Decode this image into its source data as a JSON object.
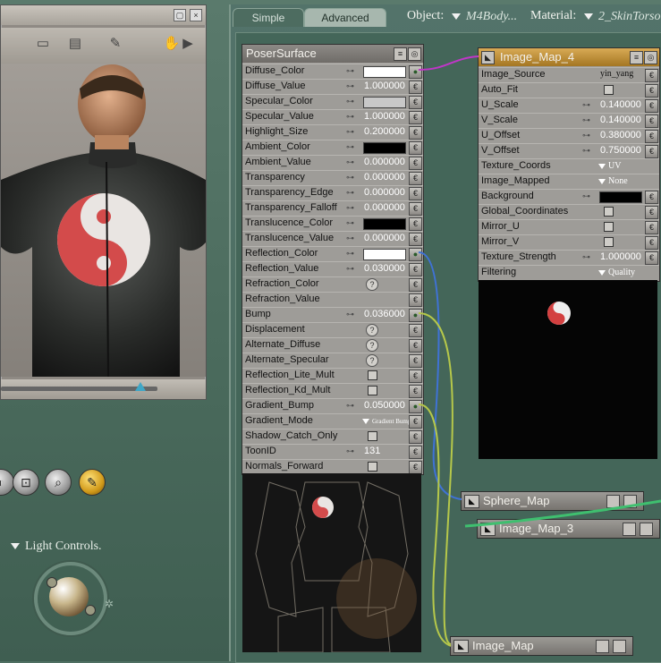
{
  "tabs": [
    {
      "label": "Simple"
    },
    {
      "label": "Advanced"
    }
  ],
  "header": {
    "object_label": "Object:",
    "object_value": "M4Body...",
    "material_label": "Material:",
    "material_value": "2_SkinTorso"
  },
  "viewport": {
    "light_controls_label": "Light Controls."
  },
  "poser_surface": {
    "title": "PoserSurface",
    "rows": [
      {
        "label": "Diffuse_Color",
        "value": "",
        "kind": "color",
        "color": "#ffffff",
        "plug": "connected"
      },
      {
        "label": "Diffuse_Value",
        "value": "1.000000",
        "kind": "number"
      },
      {
        "label": "Specular_Color",
        "value": "",
        "kind": "color",
        "color": "#c8c8c8"
      },
      {
        "label": "Specular_Value",
        "value": "1.000000",
        "kind": "number"
      },
      {
        "label": "Highlight_Size",
        "value": "0.200000",
        "kind": "number"
      },
      {
        "label": "Ambient_Color",
        "value": "",
        "kind": "color",
        "color": "#000000"
      },
      {
        "label": "Ambient_Value",
        "value": "0.000000",
        "kind": "number"
      },
      {
        "label": "Transparency",
        "value": "0.000000",
        "kind": "number"
      },
      {
        "label": "Transparency_Edge",
        "value": "0.000000",
        "kind": "number"
      },
      {
        "label": "Transparency_Falloff",
        "value": "0.000000",
        "kind": "number"
      },
      {
        "label": "Translucence_Color",
        "value": "",
        "kind": "color",
        "color": "#000000"
      },
      {
        "label": "Translucence_Value",
        "value": "0.000000",
        "kind": "number"
      },
      {
        "label": "Reflection_Color",
        "value": "",
        "kind": "color",
        "color": "#ffffff",
        "plug": "connected"
      },
      {
        "label": "Reflection_Value",
        "value": "0.030000",
        "kind": "number"
      },
      {
        "label": "Refraction_Color",
        "value": "",
        "kind": "query"
      },
      {
        "label": "Refraction_Value",
        "value": "",
        "kind": "empty"
      },
      {
        "label": "Bump",
        "value": "0.036000",
        "kind": "number",
        "plug": "connected"
      },
      {
        "label": "Displacement",
        "value": "",
        "kind": "query"
      },
      {
        "label": "Alternate_Diffuse",
        "value": "",
        "kind": "query"
      },
      {
        "label": "Alternate_Specular",
        "value": "",
        "kind": "query"
      },
      {
        "label": "Reflection_Lite_Mult",
        "value": "",
        "kind": "check"
      },
      {
        "label": "Reflection_Kd_Mult",
        "value": "",
        "kind": "check"
      },
      {
        "label": "Gradient_Bump",
        "value": "0.050000",
        "kind": "number",
        "plug": "connected"
      },
      {
        "label": "Gradient_Mode",
        "value": "Gradient Bump",
        "kind": "dropdown"
      },
      {
        "label": "Shadow_Catch_Only",
        "value": "",
        "kind": "check"
      },
      {
        "label": "ToonID",
        "value": "131",
        "kind": "number"
      },
      {
        "label": "Normals_Forward",
        "value": "",
        "kind": "check"
      }
    ]
  },
  "image_map_4": {
    "title": "Image_Map_4",
    "rows": [
      {
        "label": "Image_Source",
        "value": "yin_yang",
        "kind": "text"
      },
      {
        "label": "Auto_Fit",
        "value": "",
        "kind": "check"
      },
      {
        "label": "U_Scale",
        "value": "0.140000",
        "kind": "number"
      },
      {
        "label": "V_Scale",
        "value": "0.140000",
        "kind": "number"
      },
      {
        "label": "U_Offset",
        "value": "0.380000",
        "kind": "number"
      },
      {
        "label": "V_Offset",
        "value": "0.750000",
        "kind": "number"
      },
      {
        "label": "Texture_Coords",
        "value": "UV",
        "kind": "dropdown"
      },
      {
        "label": "Image_Mapped",
        "value": "None",
        "kind": "dropdown"
      },
      {
        "label": "Background",
        "value": "",
        "kind": "color",
        "color": "#000000"
      },
      {
        "label": "Global_Coordinates",
        "value": "",
        "kind": "check"
      },
      {
        "label": "Mirror_U",
        "value": "",
        "kind": "check"
      },
      {
        "label": "Mirror_V",
        "value": "",
        "kind": "check"
      },
      {
        "label": "Texture_Strength",
        "value": "1.000000",
        "kind": "number"
      },
      {
        "label": "Filtering",
        "value": "Quality",
        "kind": "dropdown"
      }
    ]
  },
  "collapsed_nodes": [
    {
      "title": "Sphere_Map"
    },
    {
      "title": "Image_Map_3"
    },
    {
      "title": "Image_Map"
    }
  ]
}
